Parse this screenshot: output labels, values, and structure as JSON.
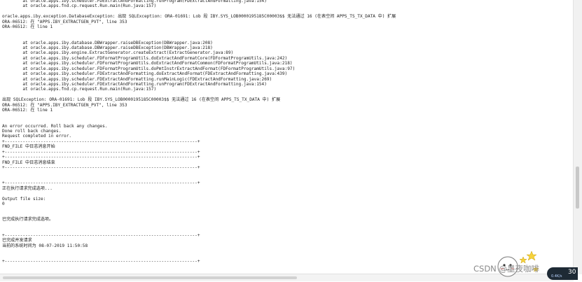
{
  "log_lines": [
    "        at oracle.apps.iby.scheduler.FDExtractAndFormatting.runProgram(FDExtractAndFormatting.java:154)",
    "        at oracle.apps.fnd.cp.request.Run.main(Run.java:157)",
    "",
    "oracle.apps.iby.exception.DatabaseException: 出现 SQLException: ORA-01691: Lob 段 IBY.SYS_LOB0000195185C00003$$ 无法通过 16 (在表空间 APPS_TS_TX_DATA 中) 扩展",
    "ORA-06512: 在 \"APPS.IBY_EXTRACTGEN_PVT\", line 353",
    "ORA-06512: 在 line 1",
    "",
    "",
    "        at oracle.apps.iby.database.DBWrapper.raiseDBException(DBWrapper.java:208)",
    "        at oracle.apps.iby.database.DBWrapper.raiseDBException(DBWrapper.java:218)",
    "        at oracle.apps.iby.engine.ExtractGenerator.createExtract(ExtractGenerator.java:89)",
    "        at oracle.apps.iby.scheduler.FDFormatProgramUtils.doExtractAndFormatCore(FDFormatProgramUtils.java:242)",
    "        at oracle.apps.iby.scheduler.FDFormatProgramUtils.doExtractAndFormatCommon(FDFormatProgramUtils.java:218)",
    "        at oracle.apps.iby.scheduler.FDFormatProgramUtils.doPmtInstrExtractAndFormat(FDFormatProgramUtils.java:97)",
    "        at oracle.apps.iby.scheduler.FDExtractAndFormatting.doExtractAndFormat(FDExtractAndFormatting.java:439)",
    "        at oracle.apps.iby.scheduler.FDExtractAndFormatting.runMainLogic(FDExtractAndFormatting.java:269)",
    "        at oracle.apps.iby.scheduler.FDExtractAndFormatting.runProgram(FDExtractAndFormatting.java:154)",
    "        at oracle.apps.fnd.cp.request.Run.main(Run.java:157)",
    "",
    "出现 SQLException: ORA-01691: Lob 段 IBY.SYS_LOB0000195185C00003$$ 无法通过 16 (在表空间 APPS_TS_TX_DATA 中) 扩展",
    "ORA-06512: 在 \"APPS.IBY_EXTRACTGEN_PVT\", line 353",
    "ORA-06512: 在 line 1",
    "",
    "",
    "An error occurred. Roll back any changes.",
    "Done roll back changes.",
    "Request completed in error.",
    "+---------------------------------------------------------------------------+",
    "FND_FILE 中日志消息开始",
    "+---------------------------------------------------------------------------+",
    "+---------------------------------------------------------------------------+",
    "FND_FILE 中日志消息结束",
    "+---------------------------------------------------------------------------+",
    "",
    "",
    "+---------------------------------------------------------------------------+",
    "正在执行请求完成选项...",
    "",
    "Output file size:",
    "0",
    "",
    "",
    "已完成执行请求完成选项。",
    "",
    "",
    "+---------------------------------------------------------------------------+",
    "已完成并发请求",
    "当前的系统时间为 08-07-2019 11:50:58",
    "",
    "",
    "+---------------------------------------------------------------------------+"
  ],
  "watermark": "CSDN @墨夜咖啡",
  "perf_widget": {
    "main": "30",
    "sub": "0.4K/s"
  }
}
